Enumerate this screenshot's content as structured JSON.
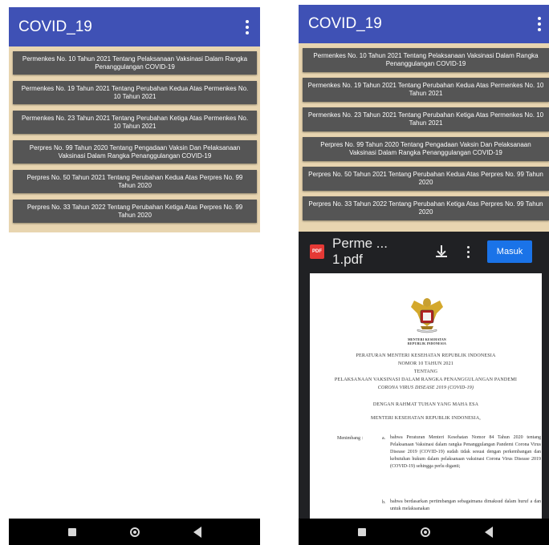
{
  "app": {
    "title": "COVID_19"
  },
  "items": [
    "Permenkes No. 10 Tahun 2021 Tentang Pelaksanaan Vaksinasi Dalam Rangka Penanggulangan COVID-19",
    "Permenkes No. 19 Tahun 2021 Tentang Perubahan Kedua Atas Permenkes No. 10 Tahun 2021",
    "Permenkes No. 23 Tahun 2021 Tentang Perubahan Ketiga Atas Permenkes No. 10 Tahun 2021",
    "Perpres No. 99 Tahun 2020 Tentang Pengadaan Vaksin Dan Pelaksanaan Vaksinasi Dalam Rangka Penanggulangan COVID-19",
    "Perpres No. 50 Tahun 2021 Tentang Perubahan Kedua Atas Perpres No. 99 Tahun 2020",
    "Perpres No. 33 Tahun 2022 Tentang Perubahan Ketiga Atas Perpres No. 99 Tahun 2020"
  ],
  "pdf": {
    "badge": "PDF",
    "filename": "Perme ... 1.pdf",
    "signin_label": "Masuk",
    "emblem_text": "MENTERI KESEHATAN REPUBLIK INDONESIA",
    "heading": [
      "PERATURAN MENTERI KESEHATAN REPUBLIK INDONESIA",
      "NOMOR 10 TAHUN 2021",
      "TENTANG",
      "PELAKSANAAN VAKSINASI DALAM RANGKA PENANGGULANGAN PANDEMI",
      "CORONA VIRUS DISEASE 2019 (COVID-19)"
    ],
    "rahmat": "DENGAN RAHMAT TUHAN YANG MAHA ESA",
    "menteri": "MENTERI KESEHATAN REPUBLIK INDONESIA,",
    "menimbang": "Menimbang :",
    "point_a": "a.",
    "point_b": "b.",
    "clause_a": "bahwa Peraturan Menteri Kesehatan Nomor 84 Tahun 2020 tentang Pelaksanaan Vaksinasi dalam rangka Penanggulangan Pandemi Corona Virus Disease 2019 (COVID-19) sudah tidak sesuai dengan perkembangan dan kebutuhan hukum dalam pelaksanaan vaksinasi Corona Virus Disease 2019 (COVID-19) sehingga perlu diganti;",
    "clause_b": "bahwa berdasarkan pertimbangan sebagaimana dimaksud dalam huruf a dan untuk melaksanakan"
  }
}
